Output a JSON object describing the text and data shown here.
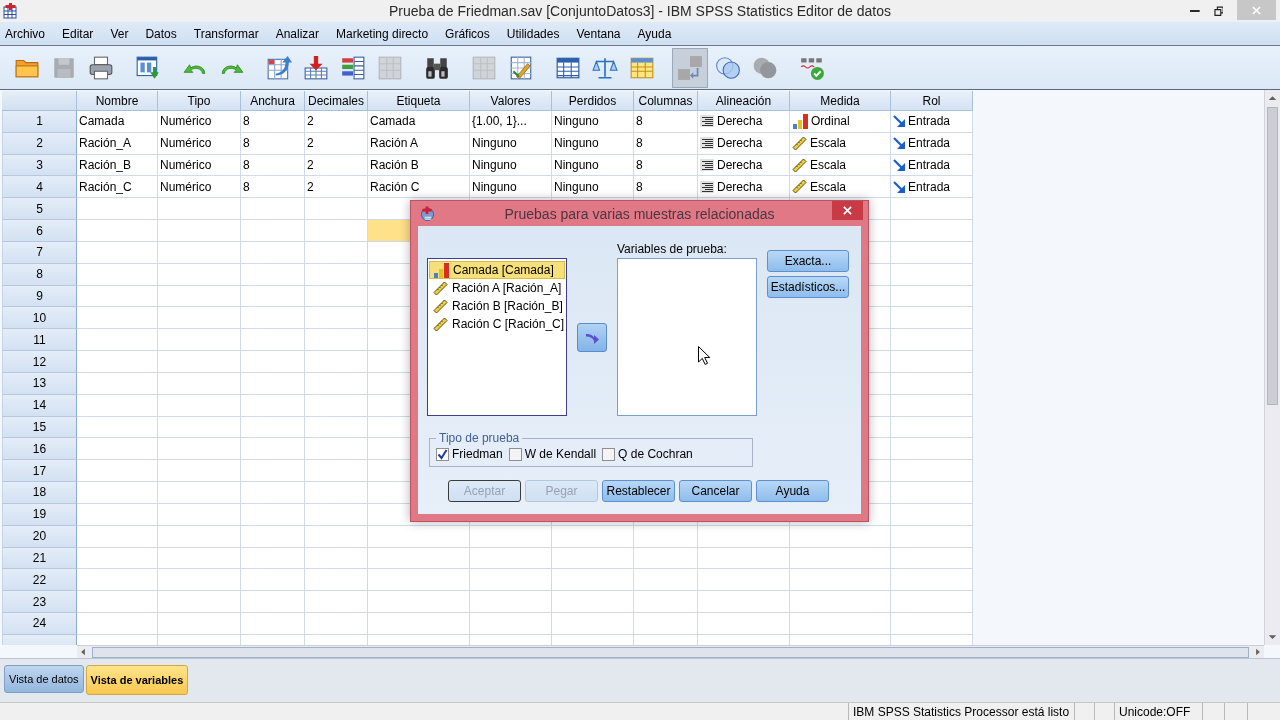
{
  "window": {
    "title": "Prueba de Friedman.sav [ConjuntoDatos3] - IBM SPSS Statistics Editor de datos"
  },
  "menu": [
    "Archivo",
    "Editar",
    "Ver",
    "Datos",
    "Transformar",
    "Analizar",
    "Marketing directo",
    "Gráficos",
    "Utilidades",
    "Ventana",
    "Ayuda"
  ],
  "toolbar": [
    {
      "disabled": false,
      "pressed": false
    },
    {
      "disabled": true,
      "pressed": false
    },
    {
      "disabled": false,
      "pressed": false
    },
    {
      "disabled": false,
      "pressed": false
    },
    {
      "disabled": false,
      "pressed": false
    },
    {
      "disabled": false,
      "pressed": false
    },
    {
      "disabled": false,
      "pressed": false
    },
    {
      "disabled": false,
      "pressed": false
    },
    {
      "disabled": false,
      "pressed": false
    },
    {
      "disabled": true,
      "pressed": false
    },
    {
      "disabled": false,
      "pressed": false
    },
    {
      "disabled": true,
      "pressed": false
    },
    {
      "disabled": false,
      "pressed": false
    },
    {
      "disabled": false,
      "pressed": false
    },
    {
      "disabled": false,
      "pressed": false
    },
    {
      "disabled": false,
      "pressed": false
    },
    {
      "disabled": false,
      "pressed": true
    },
    {
      "disabled": false,
      "pressed": false
    },
    {
      "disabled": true,
      "pressed": false
    },
    {
      "disabled": false,
      "pressed": false
    }
  ],
  "grid": {
    "columns": [
      "Nombre",
      "Tipo",
      "Anchura",
      "Decimales",
      "Etiqueta",
      "Valores",
      "Perdidos",
      "Columnas",
      "Alineación",
      "Medida",
      "Rol"
    ],
    "rows": [
      {
        "number": "1",
        "cells": [
          {
            "text": "Camada",
            "kind": "text",
            "selected": false
          },
          {
            "text": "Numérico",
            "kind": "text",
            "selected": false
          },
          {
            "text": "8",
            "kind": "text",
            "selected": false
          },
          {
            "text": "2",
            "kind": "text",
            "selected": false
          },
          {
            "text": "Camada",
            "kind": "text",
            "selected": false
          },
          {
            "text": "{1.00, 1}...",
            "kind": "text",
            "selected": false
          },
          {
            "text": "Ninguno",
            "kind": "text",
            "selected": false
          },
          {
            "text": "8",
            "kind": "text",
            "selected": false
          },
          {
            "text": "Derecha",
            "kind": "align",
            "selected": false
          },
          {
            "text": "Ordinal",
            "kind": "ordinal",
            "selected": false
          },
          {
            "text": "Entrada",
            "kind": "input",
            "selected": false
          }
        ]
      },
      {
        "number": "2",
        "cells": [
          {
            "text": "Ración_A",
            "kind": "text",
            "selected": false
          },
          {
            "text": "Numérico",
            "kind": "text",
            "selected": false
          },
          {
            "text": "8",
            "kind": "text",
            "selected": false
          },
          {
            "text": "2",
            "kind": "text",
            "selected": false
          },
          {
            "text": "Ración A",
            "kind": "text",
            "selected": false
          },
          {
            "text": "Ninguno",
            "kind": "text",
            "selected": false
          },
          {
            "text": "Ninguno",
            "kind": "text",
            "selected": false
          },
          {
            "text": "8",
            "kind": "text",
            "selected": false
          },
          {
            "text": "Derecha",
            "kind": "align",
            "selected": false
          },
          {
            "text": "Escala",
            "kind": "scale",
            "selected": false
          },
          {
            "text": "Entrada",
            "kind": "input",
            "selected": false
          }
        ]
      },
      {
        "number": "3",
        "cells": [
          {
            "text": "Ración_B",
            "kind": "text",
            "selected": false
          },
          {
            "text": "Numérico",
            "kind": "text",
            "selected": false
          },
          {
            "text": "8",
            "kind": "text",
            "selected": false
          },
          {
            "text": "2",
            "kind": "text",
            "selected": false
          },
          {
            "text": "Ración B",
            "kind": "text",
            "selected": false
          },
          {
            "text": "Ninguno",
            "kind": "text",
            "selected": false
          },
          {
            "text": "Ninguno",
            "kind": "text",
            "selected": false
          },
          {
            "text": "8",
            "kind": "text",
            "selected": false
          },
          {
            "text": "Derecha",
            "kind": "align",
            "selected": false
          },
          {
            "text": "Escala",
            "kind": "scale",
            "selected": false
          },
          {
            "text": "Entrada",
            "kind": "input",
            "selected": false
          }
        ]
      },
      {
        "number": "4",
        "cells": [
          {
            "text": "Ración_C",
            "kind": "text",
            "selected": false
          },
          {
            "text": "Numérico",
            "kind": "text",
            "selected": false
          },
          {
            "text": "8",
            "kind": "text",
            "selected": false
          },
          {
            "text": "2",
            "kind": "text",
            "selected": false
          },
          {
            "text": "Ración C",
            "kind": "text",
            "selected": false
          },
          {
            "text": "Ninguno",
            "kind": "text",
            "selected": false
          },
          {
            "text": "Ninguno",
            "kind": "text",
            "selected": false
          },
          {
            "text": "8",
            "kind": "text",
            "selected": false
          },
          {
            "text": "Derecha",
            "kind": "align",
            "selected": false
          },
          {
            "text": "Escala",
            "kind": "scale",
            "selected": false
          },
          {
            "text": "Entrada",
            "kind": "input",
            "selected": false
          }
        ]
      },
      {
        "number": "5"
      },
      {
        "number": "6",
        "cells": [
          null,
          null,
          null,
          null,
          {
            "selected": true
          }
        ]
      },
      {
        "number": "7"
      },
      {
        "number": "8"
      },
      {
        "number": "9"
      },
      {
        "number": "10"
      },
      {
        "number": "11"
      },
      {
        "number": "12"
      },
      {
        "number": "13"
      },
      {
        "number": "14"
      },
      {
        "number": "15"
      },
      {
        "number": "16"
      },
      {
        "number": "17"
      },
      {
        "number": "18"
      },
      {
        "number": "19"
      },
      {
        "number": "20"
      },
      {
        "number": "21"
      },
      {
        "number": "22"
      },
      {
        "number": "23"
      },
      {
        "number": "24"
      }
    ]
  },
  "dialog": {
    "title": "Pruebas para varias muestras relacionadas",
    "source_list": [
      {
        "label": "Camada [Camada]",
        "kind": "ordinal",
        "selected": true
      },
      {
        "label": "Ración A [Ración_A]",
        "kind": "scale",
        "selected": false
      },
      {
        "label": "Ración B [Ración_B]",
        "kind": "scale",
        "selected": false
      },
      {
        "label": "Ración C [Ración_C]",
        "kind": "scale",
        "selected": false
      }
    ],
    "target_list": {
      "label": "Variables de prueba:"
    },
    "side_buttons": [
      "Exacta...",
      "Estadísticos..."
    ],
    "test_type": {
      "title": "Tipo de prueba",
      "options": [
        {
          "label": "Friedman",
          "checked": true
        },
        {
          "label": "W de Kendall",
          "checked": false
        },
        {
          "label": "Q de Cochran",
          "checked": false
        }
      ]
    },
    "buttons": [
      {
        "label": "Aceptar",
        "disabled": true,
        "default": true
      },
      {
        "label": "Pegar",
        "disabled": true,
        "default": false
      },
      {
        "label": "Restablecer",
        "disabled": false,
        "default": false
      },
      {
        "label": "Cancelar",
        "disabled": false,
        "default": false
      },
      {
        "label": "Ayuda",
        "disabled": false,
        "default": false
      }
    ]
  },
  "view_tabs": [
    {
      "label": "Vista de datos",
      "selected": false
    },
    {
      "label": "Vista de variables",
      "selected": true
    }
  ],
  "status_bar": [
    "IBM SPSS Statistics Processor está listo",
    "Unicode:OFF"
  ]
}
